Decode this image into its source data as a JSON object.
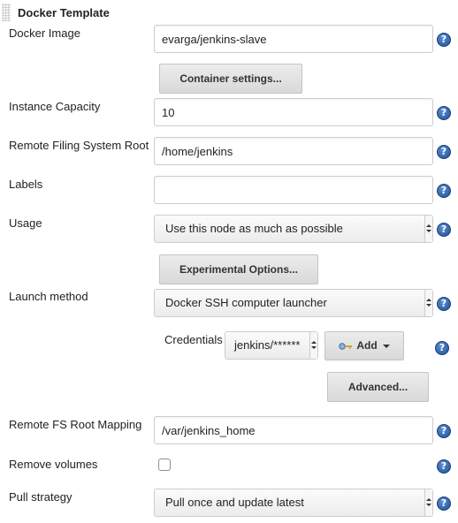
{
  "header": {
    "title": "Docker Template"
  },
  "fields": {
    "docker_image": {
      "label": "Docker Image",
      "value": "evarga/jenkins-slave"
    },
    "container_settings_button": "Container settings...",
    "instance_capacity": {
      "label": "Instance Capacity",
      "value": "10"
    },
    "remote_fs_root": {
      "label": "Remote Filing System Root",
      "value": "/home/jenkins"
    },
    "labels": {
      "label": "Labels",
      "value": ""
    },
    "usage": {
      "label": "Usage",
      "value": "Use this node as much as possible"
    },
    "experimental_button": "Experimental Options...",
    "launch_method": {
      "label": "Launch method",
      "value": "Docker SSH computer launcher"
    },
    "credentials": {
      "label": "Credentials",
      "value": "jenkins/******",
      "add_label": "Add"
    },
    "advanced_button": "Advanced...",
    "remote_fs_root_mapping": {
      "label": "Remote FS Root Mapping",
      "value": "/var/jenkins_home"
    },
    "remove_volumes": {
      "label": "Remove volumes",
      "checked": false
    },
    "pull_strategy": {
      "label": "Pull strategy",
      "value": "Pull once and update latest"
    }
  },
  "help_glyph": "?",
  "icons": [
    "grip-handle-icon",
    "help-icon",
    "key-icon",
    "dropdown-arrow-icon"
  ]
}
